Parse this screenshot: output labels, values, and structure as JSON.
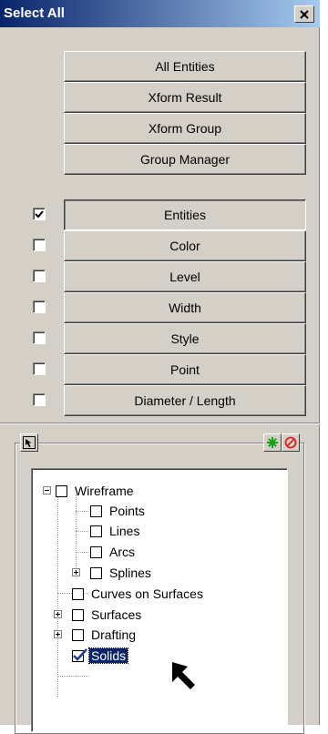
{
  "window": {
    "title": "Select All",
    "close_glyph": "✕"
  },
  "top_buttons": [
    "All Entities",
    "Xform Result",
    "Xform Group",
    "Group Manager"
  ],
  "filter_rows": [
    {
      "label": "Entities",
      "checked": true
    },
    {
      "label": "Color",
      "checked": false
    },
    {
      "label": "Level",
      "checked": false
    },
    {
      "label": "Width",
      "checked": false
    },
    {
      "label": "Style",
      "checked": false
    },
    {
      "label": "Point",
      "checked": false
    },
    {
      "label": "Diameter / Length",
      "checked": false
    }
  ],
  "tree_toolbar": {
    "left_icon": "arrow-select-icon",
    "right_icons": [
      "asterisk-all-icon",
      "no-none-icon"
    ]
  },
  "tree": {
    "wireframe": {
      "label": "Wireframe",
      "checked": false,
      "expanded": true
    },
    "points": {
      "label": "Points",
      "checked": false
    },
    "lines": {
      "label": "Lines",
      "checked": false
    },
    "arcs": {
      "label": "Arcs",
      "checked": false
    },
    "splines": {
      "label": "Splines",
      "checked": false,
      "expanded": false
    },
    "curves_on_surfaces": {
      "label": "Curves on Surfaces",
      "checked": false
    },
    "surfaces": {
      "label": "Surfaces",
      "checked": false,
      "expanded": false
    },
    "drafting": {
      "label": "Drafting",
      "checked": false,
      "expanded": false
    },
    "solids": {
      "label": "Solids",
      "checked": true,
      "selected": true
    }
  },
  "colors": {
    "titlebar_start": "#0a246a",
    "titlebar_end": "#a6caf0",
    "face": "#d4d0c8",
    "selection": "#0a246a"
  }
}
